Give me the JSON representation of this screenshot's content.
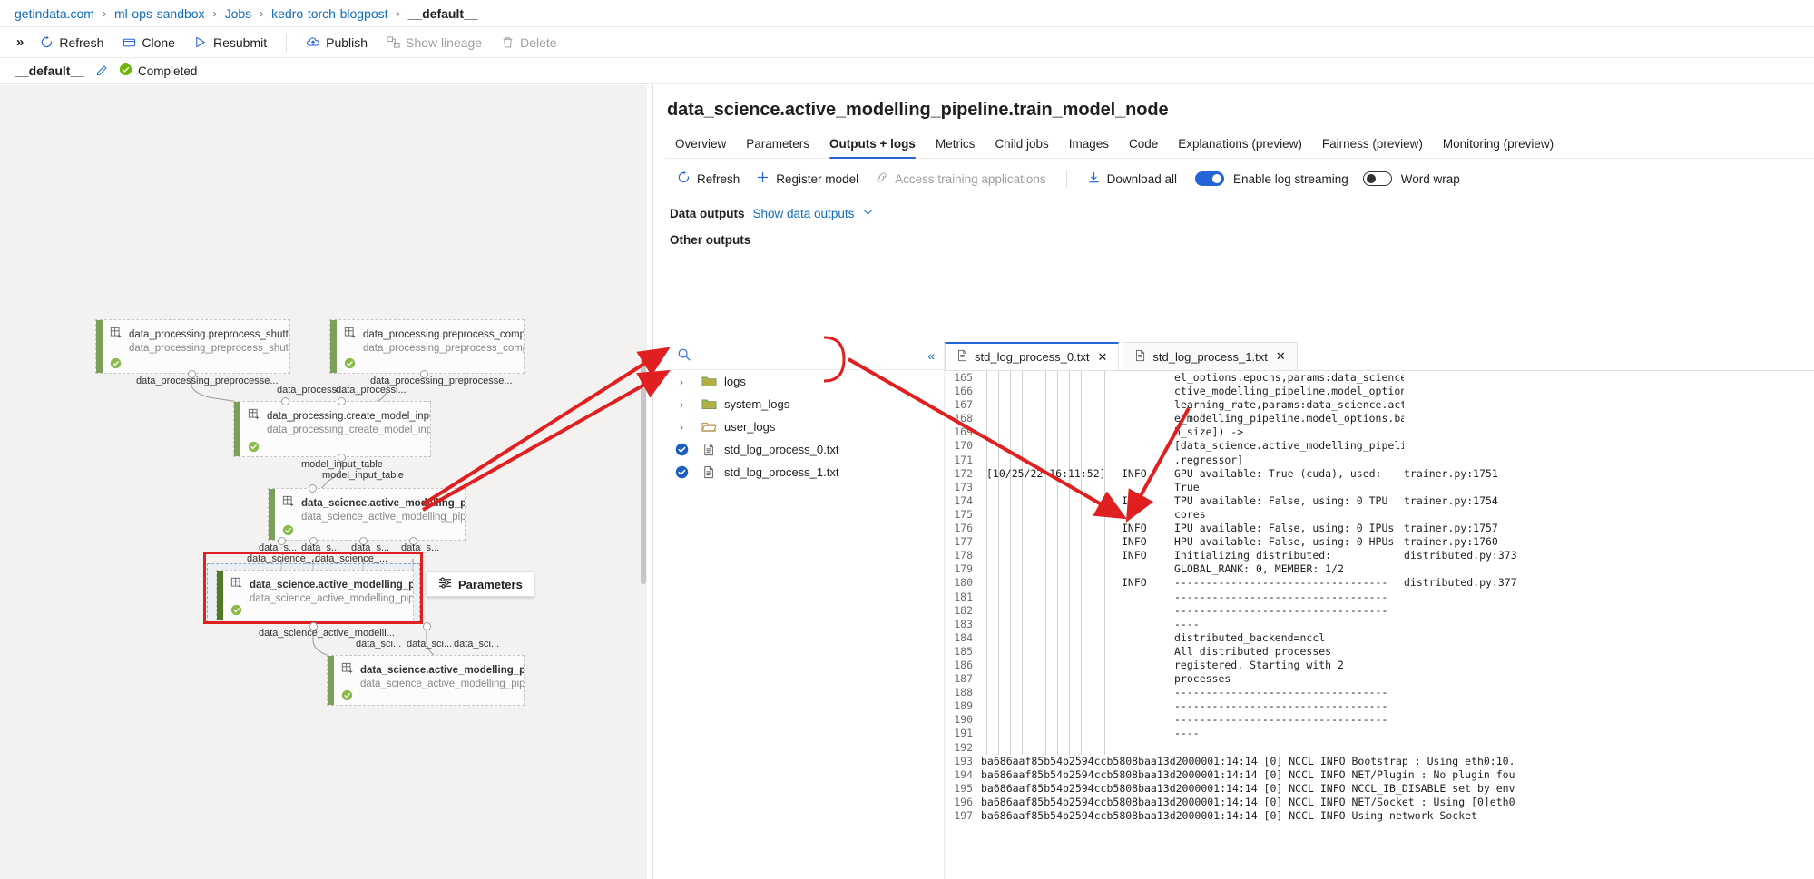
{
  "breadcrumb": {
    "items": [
      {
        "label": "getindata.com",
        "current": false
      },
      {
        "label": "ml-ops-sandbox",
        "current": false
      },
      {
        "label": "Jobs",
        "current": false
      },
      {
        "label": "kedro-torch-blogpost",
        "current": false
      },
      {
        "label": "__default__",
        "current": true
      }
    ],
    "separator": "›"
  },
  "commandbar": {
    "overflow": "»",
    "items": [
      {
        "label": "Refresh",
        "icon": "refresh-icon",
        "disabled": false
      },
      {
        "label": "Clone",
        "icon": "clone-icon",
        "disabled": false
      },
      {
        "label": "Resubmit",
        "icon": "resubmit-icon",
        "disabled": false
      },
      {
        "label": "Publish",
        "icon": "publish-icon",
        "disabled": false
      },
      {
        "label": "Show lineage",
        "icon": "lineage-icon",
        "disabled": true
      },
      {
        "label": "Delete",
        "icon": "delete-icon",
        "disabled": true
      }
    ]
  },
  "status": {
    "job_name": "__default__",
    "state": "Completed",
    "edit_icon": "pencil-icon",
    "state_icon": "success-check-icon"
  },
  "graph": {
    "nodes": [
      {
        "title": "data_processing.preprocess_shuttles_node",
        "subtitle": "data_processing_preprocess_shuttles_node",
        "selected": false
      },
      {
        "title": "data_processing.preprocess_companies_...",
        "subtitle": "data_processing_preprocess_companies_n...",
        "selected": false
      },
      {
        "title": "data_processing.create_model_input_tabl...",
        "subtitle": "data_processing_create_model_input_tabl...",
        "selected": false
      },
      {
        "title": "data_science.active_modelling_pipeline.s...",
        "subtitle": "data_science_active_modelling_pipeline_s...",
        "selected": false
      },
      {
        "title": "data_science.active_modelling_pipeline.t...",
        "subtitle": "data_science_active_modelling_pipeline_tr...",
        "selected": true
      },
      {
        "title": "data_science.active_modelling_pipeline.e...",
        "subtitle": "data_science_active_modelling_pipeline_e...",
        "selected": false
      }
    ],
    "edge_labels": [
      "data_processing_preprocesse...",
      "data_processi...",
      "data_processing_preprocesse...",
      "data_processi...",
      "model_input_table",
      "model_input_table",
      "data_s...",
      "data_s...",
      "data_s...",
      "data_s...",
      "data_science_...",
      "data_science_...",
      "data_science_active_modelli...",
      "data_sci...",
      "data_sci...",
      "data_sci..."
    ],
    "tooltip": {
      "label": "Parameters",
      "icon": "parameters-icon"
    }
  },
  "detail": {
    "title": "data_science.active_modelling_pipeline.train_model_node",
    "tabs": [
      {
        "label": "Overview",
        "active": false
      },
      {
        "label": "Parameters",
        "active": false
      },
      {
        "label": "Outputs + logs",
        "active": true
      },
      {
        "label": "Metrics",
        "active": false
      },
      {
        "label": "Child jobs",
        "active": false
      },
      {
        "label": "Images",
        "active": false
      },
      {
        "label": "Code",
        "active": false
      },
      {
        "label": "Explanations (preview)",
        "active": false
      },
      {
        "label": "Fairness (preview)",
        "active": false
      },
      {
        "label": "Monitoring (preview)",
        "active": false
      }
    ],
    "toolbar": [
      {
        "label": "Refresh",
        "icon": "refresh-icon",
        "disabled": false
      },
      {
        "label": "Register model",
        "icon": "plus-icon",
        "disabled": false
      },
      {
        "label": "Access training applications",
        "icon": "link-icon",
        "disabled": true
      },
      {
        "label": "Download all",
        "icon": "download-icon",
        "disabled": false
      }
    ],
    "toggles": [
      {
        "label": "Enable log streaming",
        "state": "on"
      },
      {
        "label": "Word wrap",
        "state": "off"
      }
    ],
    "data_outputs_label": "Data outputs",
    "show_data_outputs_link": "Show data outputs",
    "other_outputs_label": "Other outputs",
    "search_placeholder": "",
    "collapse_icon": "collapse-left-icon",
    "files": [
      {
        "name": "logs",
        "type": "folder",
        "expandable": true,
        "selected": false
      },
      {
        "name": "system_logs",
        "type": "folder",
        "expandable": true,
        "selected": false
      },
      {
        "name": "user_logs",
        "type": "folder-open",
        "expandable": true,
        "selected": false
      },
      {
        "name": "std_log_process_0.txt",
        "type": "file",
        "expandable": false,
        "selected": true
      },
      {
        "name": "std_log_process_1.txt",
        "type": "file",
        "expandable": false,
        "selected": true
      }
    ],
    "log_tabs": [
      {
        "label": "std_log_process_0.txt",
        "active": true,
        "close": "✕"
      },
      {
        "label": "std_log_process_1.txt",
        "active": false,
        "close": "✕"
      }
    ]
  },
  "log": {
    "lines": [
      {
        "n": "165",
        "time": "",
        "level": "",
        "msg": "el_options.epochs,params:data_science.a",
        "src": ""
      },
      {
        "n": "166",
        "time": "",
        "level": "",
        "msg": "ctive_modelling_pipeline.model_options.",
        "src": ""
      },
      {
        "n": "167",
        "time": "",
        "level": "",
        "msg": "learning_rate,params:data_science.activ",
        "src": ""
      },
      {
        "n": "168",
        "time": "",
        "level": "",
        "msg": "e_modelling_pipeline.model_options.batc",
        "src": ""
      },
      {
        "n": "169",
        "time": "",
        "level": "",
        "msg": "h_size]) ->",
        "src": ""
      },
      {
        "n": "170",
        "time": "",
        "level": "",
        "msg": "[data_science.active_modelling_pipeline",
        "src": ""
      },
      {
        "n": "171",
        "time": "",
        "level": "",
        "msg": ".regressor]",
        "src": ""
      },
      {
        "n": "172",
        "time": "[10/25/22 16:11:52]",
        "level": "INFO",
        "msg": "GPU available: True (cuda), used:",
        "src": "trainer.py:1751"
      },
      {
        "n": "173",
        "time": "",
        "level": "",
        "msg": "True",
        "src": ""
      },
      {
        "n": "174",
        "time": "",
        "level": "INFO",
        "msg": "TPU available: False, using: 0 TPU",
        "src": "trainer.py:1754"
      },
      {
        "n": "175",
        "time": "",
        "level": "",
        "msg": "cores",
        "src": ""
      },
      {
        "n": "176",
        "time": "",
        "level": "INFO",
        "msg": "IPU available: False, using: 0 IPUs",
        "src": "trainer.py:1757"
      },
      {
        "n": "177",
        "time": "",
        "level": "INFO",
        "msg": "HPU available: False, using: 0 HPUs",
        "src": "trainer.py:1760"
      },
      {
        "n": "178",
        "time": "",
        "level": "INFO",
        "msg": "Initializing distributed:",
        "src": "distributed.py:373"
      },
      {
        "n": "179",
        "time": "",
        "level": "",
        "msg": "GLOBAL_RANK: 0, MEMBER: 1/2",
        "src": ""
      },
      {
        "n": "180",
        "time": "",
        "level": "INFO",
        "msg": "----------------------------------",
        "src": "distributed.py:377"
      },
      {
        "n": "181",
        "time": "",
        "level": "",
        "msg": "----------------------------------",
        "src": ""
      },
      {
        "n": "182",
        "time": "",
        "level": "",
        "msg": "----------------------------------",
        "src": ""
      },
      {
        "n": "183",
        "time": "",
        "level": "",
        "msg": "----",
        "src": ""
      },
      {
        "n": "184",
        "time": "",
        "level": "",
        "msg": "distributed_backend=nccl",
        "src": ""
      },
      {
        "n": "185",
        "time": "",
        "level": "",
        "msg": "All distributed processes",
        "src": ""
      },
      {
        "n": "186",
        "time": "",
        "level": "",
        "msg": "registered. Starting with 2",
        "src": ""
      },
      {
        "n": "187",
        "time": "",
        "level": "",
        "msg": "processes",
        "src": ""
      },
      {
        "n": "188",
        "time": "",
        "level": "",
        "msg": "----------------------------------",
        "src": ""
      },
      {
        "n": "189",
        "time": "",
        "level": "",
        "msg": "----------------------------------",
        "src": ""
      },
      {
        "n": "190",
        "time": "",
        "level": "",
        "msg": "----------------------------------",
        "src": ""
      },
      {
        "n": "191",
        "time": "",
        "level": "",
        "msg": "----",
        "src": ""
      },
      {
        "n": "192",
        "time": "",
        "level": "",
        "msg": "",
        "src": ""
      }
    ],
    "wide_lines": [
      {
        "n": "193",
        "msg": "ba686aaf85b54b2594ccb5808baa13d2000001:14:14 [0] NCCL INFO Bootstrap : Using eth0:10."
      },
      {
        "n": "194",
        "msg": "ba686aaf85b54b2594ccb5808baa13d2000001:14:14 [0] NCCL INFO NET/Plugin : No plugin fou"
      },
      {
        "n": "195",
        "msg": "ba686aaf85b54b2594ccb5808baa13d2000001:14:14 [0] NCCL INFO NCCL_IB_DISABLE set by env"
      },
      {
        "n": "196",
        "msg": "ba686aaf85b54b2594ccb5808baa13d2000001:14:14 [0] NCCL INFO NET/Socket : Using [0]eth0"
      },
      {
        "n": "197",
        "msg": "ba686aaf85b54b2594ccb5808baa13d2000001:14:14 [0] NCCL INFO Using network Socket"
      }
    ]
  },
  "colors": {
    "accent": "#2563d9",
    "link": "#0f6cbd",
    "success": "#6bb700",
    "annotation": "#e02020",
    "node_bar": "#7ba05b"
  }
}
